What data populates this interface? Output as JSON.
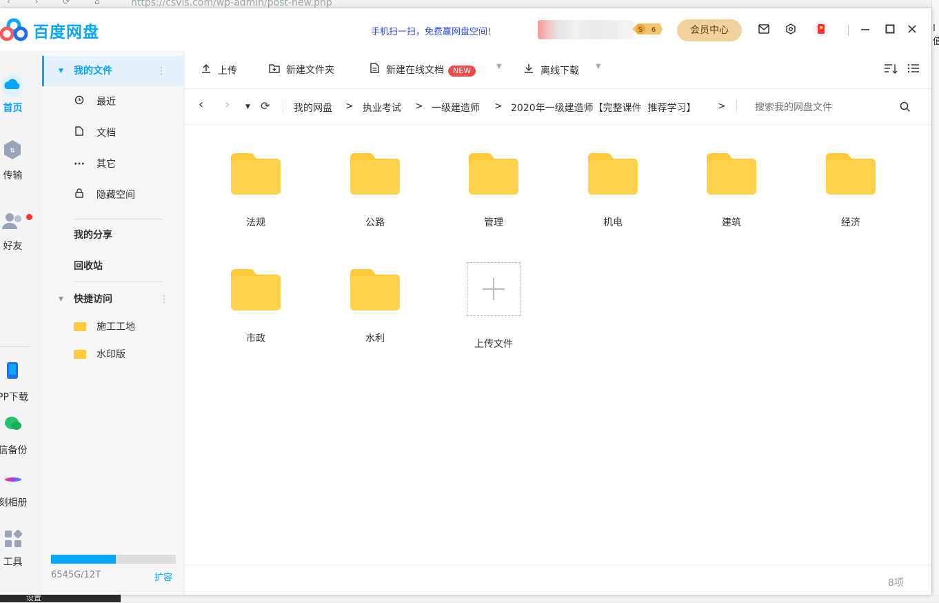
{
  "browser": {
    "url": "https://csvis.com/wp-admin/post-new.php",
    "bottom_label": "设置",
    "right_fragment": "I值"
  },
  "app": {
    "title": "百度网盘",
    "promo": "手机扫一扫，免费赢网盘空间!",
    "vip_level": "6",
    "vip_button": "会员中心"
  },
  "leftnav": [
    {
      "label": "首页",
      "icon": "cloud-icon",
      "active": true
    },
    {
      "label": "传输",
      "icon": "transfer-icon"
    },
    {
      "label": "好友",
      "icon": "friends-icon"
    },
    {
      "label": "PP下载",
      "icon": "phone-icon"
    },
    {
      "label": "信备份",
      "icon": "wechat-backup-icon"
    },
    {
      "label": "刻相册",
      "icon": "album-icon"
    },
    {
      "label": "工具",
      "icon": "tools-icon"
    }
  ],
  "sidebar": {
    "my_files": "我的文件",
    "recent": "最近",
    "docs": "文档",
    "other": "其它",
    "hidden": "隐藏空间",
    "my_share": "我的分享",
    "recycle": "回收站",
    "quick_access": "快捷访问",
    "quick": [
      {
        "label": "施工工地"
      },
      {
        "label": "水印版"
      }
    ],
    "usage": "6545G/12T",
    "usage_fraction": 0.52,
    "expand": "扩容"
  },
  "toolbar": {
    "upload": "上传",
    "new_folder": "新建文件夹",
    "new_doc": "新建在线文档",
    "new_badge": "NEW",
    "offline": "离线下载"
  },
  "path": {
    "crumbs": [
      "我的网盘",
      "执业考试",
      "一级建造师",
      "2020年一级建造师【完整课件  推荐学习】"
    ],
    "sep": ">",
    "search_placeholder": "搜索我的网盘文件"
  },
  "folders": [
    {
      "name": "法规"
    },
    {
      "name": "公路"
    },
    {
      "name": "管理"
    },
    {
      "name": "机电"
    },
    {
      "name": "建筑"
    },
    {
      "name": "经济"
    },
    {
      "name": "市政"
    },
    {
      "name": "水利"
    }
  ],
  "upload_tile": "上传文件",
  "footer": {
    "count": "8项"
  },
  "colors": {
    "accent": "#06a7ff",
    "folder": "#ffd24d",
    "vip": "#f2d19c",
    "new_badge": "#f14c4c"
  }
}
